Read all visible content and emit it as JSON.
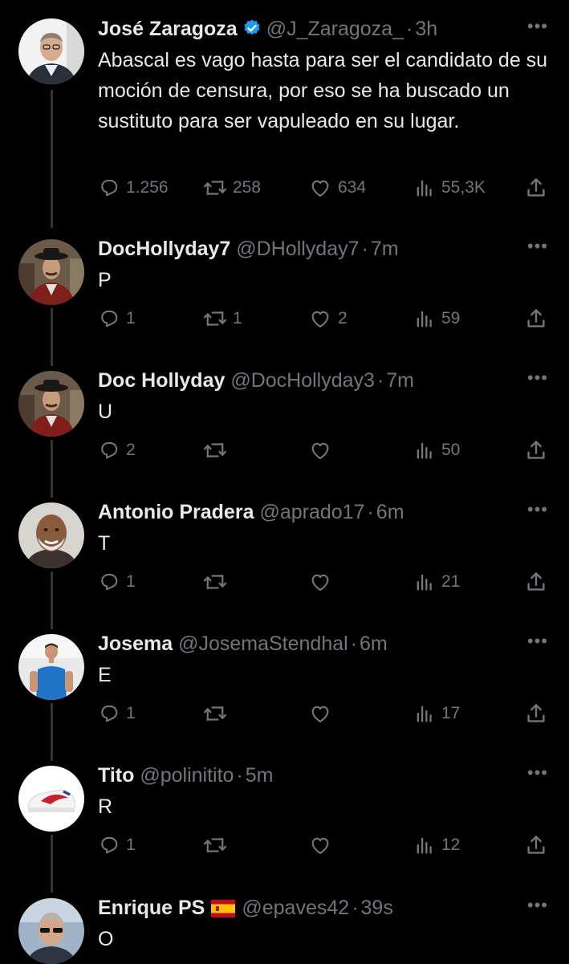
{
  "tweets": [
    {
      "name": "José Zaragoza",
      "verified": true,
      "flag": false,
      "handle": "@J_Zaragoza_",
      "time": "3h",
      "more": "•••",
      "text": "Abascal es vago hasta para ser el candidato de su moción de censura, por eso se ha buscado un sustituto para ser vapuleado en su lugar.",
      "replies": "1.256",
      "retweets": "258",
      "likes": "634",
      "views": "55,3K"
    },
    {
      "name": "DocHollyday7",
      "handle": "@DHollyday7",
      "time": "7m",
      "more": "•••",
      "text": "P",
      "replies": "1",
      "retweets": "1",
      "likes": "2",
      "views": "59"
    },
    {
      "name": "Doc Hollyday",
      "handle": "@DocHollyday3",
      "time": "7m",
      "more": "•••",
      "text": "U",
      "replies": "2",
      "retweets": "",
      "likes": "",
      "views": "50"
    },
    {
      "name": "Antonio Pradera",
      "handle": "@aprado17",
      "time": "6m",
      "more": "•••",
      "text": "T",
      "replies": "1",
      "retweets": "",
      "likes": "",
      "views": "21"
    },
    {
      "name": "Josema",
      "handle": "@JosemaStendhal",
      "time": "6m",
      "more": "•••",
      "text": "E",
      "replies": "1",
      "retweets": "",
      "likes": "",
      "views": "17"
    },
    {
      "name": "Tito",
      "handle": "@polinitito",
      "time": "5m",
      "more": "•••",
      "text": "R",
      "replies": "1",
      "retweets": "",
      "likes": "",
      "views": "12"
    },
    {
      "name": "Enrique PS",
      "flag_emoji": "🇪🇸",
      "handle": "@epaves42",
      "time": "39s",
      "more": "•••",
      "text": "O"
    }
  ],
  "colors": {
    "background": "#000000",
    "text": "#e7e9ea",
    "muted": "#71767b",
    "verified": "#1d9bf0",
    "thread_line": "#333639"
  },
  "icons": [
    "reply-icon",
    "retweet-icon",
    "like-icon",
    "views-icon",
    "share-icon",
    "verified-badge-icon",
    "more-icon"
  ]
}
